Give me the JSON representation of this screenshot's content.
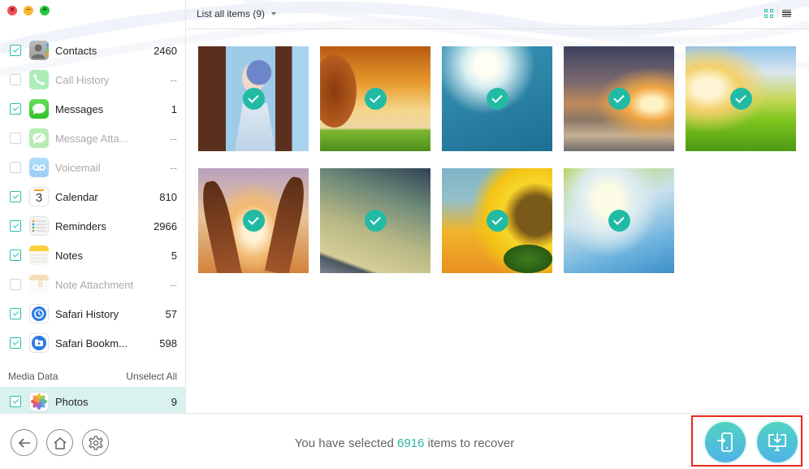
{
  "window": {
    "controls": [
      "close",
      "minimize",
      "maximize"
    ]
  },
  "sidebar": {
    "categories": [
      {
        "label": "Contacts",
        "count": "2460",
        "checked": true,
        "enabled": true,
        "icon": "contacts-icon"
      },
      {
        "label": "Call History",
        "count": "--",
        "checked": false,
        "enabled": false,
        "icon": "phone-icon"
      },
      {
        "label": "Messages",
        "count": "1",
        "checked": true,
        "enabled": true,
        "icon": "messages-icon"
      },
      {
        "label": "Message Atta...",
        "count": "--",
        "checked": false,
        "enabled": false,
        "icon": "message-attachment-icon"
      },
      {
        "label": "Voicemail",
        "count": "--",
        "checked": false,
        "enabled": false,
        "icon": "voicemail-icon"
      },
      {
        "label": "Calendar",
        "count": "810",
        "checked": true,
        "enabled": true,
        "icon": "calendar-icon"
      },
      {
        "label": "Reminders",
        "count": "2966",
        "checked": true,
        "enabled": true,
        "icon": "reminders-icon"
      },
      {
        "label": "Notes",
        "count": "5",
        "checked": true,
        "enabled": true,
        "icon": "notes-icon"
      },
      {
        "label": "Note Attachment",
        "count": "--",
        "checked": false,
        "enabled": false,
        "icon": "note-attachment-icon"
      },
      {
        "label": "Safari History",
        "count": "57",
        "checked": true,
        "enabled": true,
        "icon": "safari-history-icon"
      },
      {
        "label": "Safari Bookm...",
        "count": "598",
        "checked": true,
        "enabled": true,
        "icon": "safari-bookmarks-icon"
      }
    ],
    "media_section": {
      "title": "Media Data",
      "action": "Unselect All",
      "items": [
        {
          "label": "Photos",
          "count": "9",
          "checked": true,
          "selected": true,
          "icon": "photos-icon"
        }
      ]
    },
    "calendar_icon_day": "3"
  },
  "main": {
    "filter_label": "List all items (9)",
    "view_mode": "grid",
    "photos": [
      {
        "name": "anime-girl-flowers",
        "checked": true
      },
      {
        "name": "tree-sunset-field",
        "checked": true
      },
      {
        "name": "sun-blue-sky",
        "checked": true
      },
      {
        "name": "sunset-clouds-water",
        "checked": true
      },
      {
        "name": "sun-grass-meadow",
        "checked": true
      },
      {
        "name": "hands-sunset",
        "checked": true
      },
      {
        "name": "sea-sky-horizon",
        "checked": true
      },
      {
        "name": "sunflower",
        "checked": true
      },
      {
        "name": "leaves-sunrays",
        "checked": true
      }
    ]
  },
  "footer": {
    "status_prefix": "You have selected",
    "selected_count": "6916",
    "status_suffix": "items to recover",
    "nav_buttons": [
      "back",
      "home",
      "settings"
    ],
    "action_buttons": [
      "recover-to-device",
      "recover-to-computer"
    ]
  },
  "colors": {
    "accent": "#2bbfaa",
    "check_badge": "#21bba4",
    "selected_row": "#d9f2ef",
    "highlight_border": "#e8271c"
  }
}
